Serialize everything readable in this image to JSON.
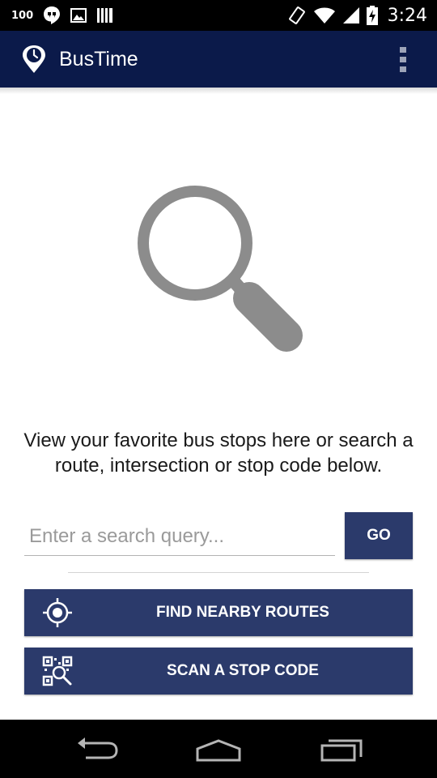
{
  "status_bar": {
    "battery_percent": "100",
    "time": "3:24",
    "left_icons": [
      "hangouts-icon",
      "image-icon",
      "barcode-icon"
    ],
    "right_icons": [
      "rotate-icon",
      "wifi-icon",
      "signal-icon",
      "battery-charging-icon"
    ]
  },
  "app_bar": {
    "title": "BusTime",
    "logo_icon": "location-clock-icon",
    "menu_icon": "overflow-menu-icon",
    "background": "#0b1a4a"
  },
  "main": {
    "hero_icon": "magnifier-icon",
    "message": "View your favorite bus stops here or search a route, intersection or stop code below."
  },
  "search": {
    "placeholder": "Enter a search query...",
    "value": "",
    "go_label": "GO"
  },
  "actions": {
    "nearby_label": "FIND NEARBY ROUTES",
    "nearby_icon": "gps-target-icon",
    "scan_label": "SCAN A STOP CODE",
    "scan_icon": "qr-scan-icon"
  },
  "colors": {
    "button": "#2b3a6b",
    "hero_icon": "#8c8c8c"
  },
  "nav_bar": {
    "buttons": [
      "back-icon",
      "home-icon",
      "recents-icon"
    ]
  }
}
